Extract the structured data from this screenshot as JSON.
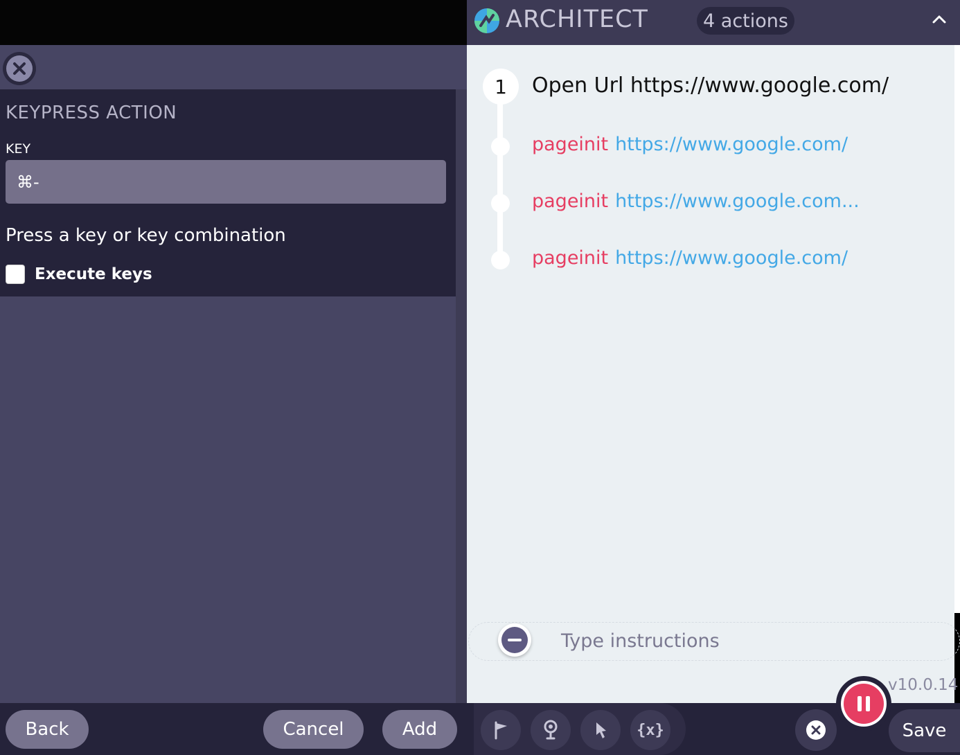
{
  "left": {
    "form_title": "KEYPRESS ACTION",
    "key_label": "KEY",
    "key_value": "⌘-",
    "hint": "Press a key or key combination",
    "execute_label": "Execute keys",
    "execute_checked": false
  },
  "footer_left": {
    "back": "Back",
    "cancel": "Cancel",
    "add": "Add"
  },
  "header": {
    "brand": "ARCHITECT",
    "actions_count": "4 actions"
  },
  "steps": [
    {
      "number": "1",
      "title": "Open Url https://www.google.com/",
      "events": [
        {
          "type": "pageinit",
          "url": "https://www.google.com/"
        },
        {
          "type": "pageinit",
          "url": "https://www.google.com..."
        },
        {
          "type": "pageinit",
          "url": "https://www.google.com/"
        }
      ]
    }
  ],
  "instructions": {
    "placeholder": "Type instructions"
  },
  "version": "v10.0.14",
  "footer_right": {
    "save": "Save",
    "var_tool": "{x}"
  },
  "colors": {
    "accent": "#e63e62",
    "link": "#43a8e6",
    "panel": "#474563",
    "dark": "#25233a"
  }
}
